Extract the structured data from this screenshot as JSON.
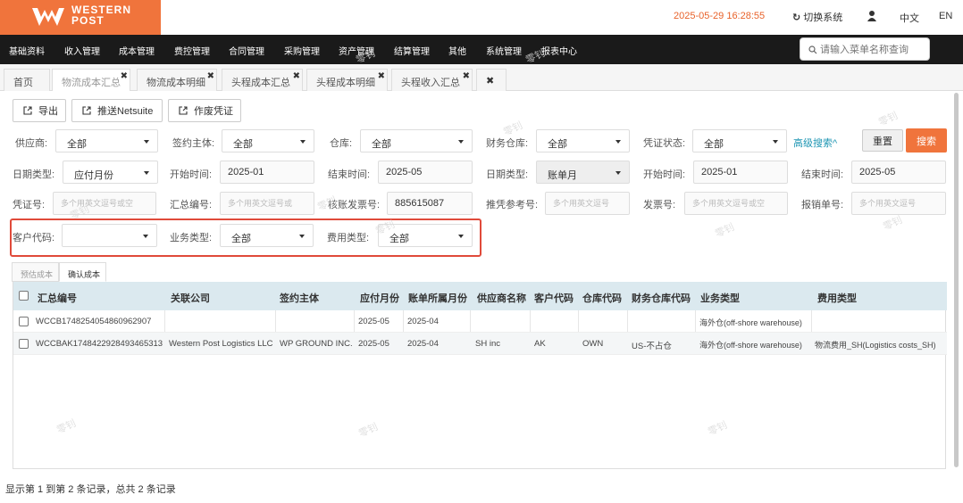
{
  "brand": {
    "line1": "WESTERN",
    "line2": "POST",
    "color": "#f0743c"
  },
  "header": {
    "datetime": "2025-05-29 16:28:55",
    "switch_system": "切换系统",
    "lang_zh": "中文",
    "lang_en": "EN"
  },
  "menu": {
    "items": [
      "基础资料",
      "收入管理",
      "成本管理",
      "费控管理",
      "合同管理",
      "采购管理",
      "资产管理",
      "结算管理",
      "其他",
      "系统管理",
      "报表中心"
    ],
    "search_placeholder": "请输入菜单名称查询"
  },
  "tabs": [
    {
      "label": "首页"
    },
    {
      "label": "物流成本汇总",
      "active": true
    },
    {
      "label": "物流成本明细"
    },
    {
      "label": "头程成本汇总"
    },
    {
      "label": "头程成本明细"
    },
    {
      "label": "头程收入汇总"
    }
  ],
  "toolbar": {
    "export": "导出",
    "push": "推送Netsuite",
    "void": "作废凭证"
  },
  "filters": {
    "supplier": {
      "label": "供应商:",
      "value": "全部"
    },
    "entity": {
      "label": "签约主体:",
      "value": "全部"
    },
    "warehouse": {
      "label": "仓库:",
      "value": "全部"
    },
    "fin_warehouse": {
      "label": "财务仓库:",
      "value": "全部"
    },
    "voucher_status": {
      "label": "凭证状态:",
      "value": "全部"
    },
    "advanced": "高级搜索^",
    "reset": "重置",
    "search": "搜索",
    "date_type1": {
      "label": "日期类型:",
      "value": "应付月份"
    },
    "start1": {
      "label": "开始时间:",
      "value": "2025-01"
    },
    "end1": {
      "label": "结束时间:",
      "value": "2025-05"
    },
    "date_type2": {
      "label": "日期类型:",
      "value": "账单月"
    },
    "start2": {
      "label": "开始时间:",
      "value": "2025-01"
    },
    "end2": {
      "label": "结束时间:",
      "value": "2025-05"
    },
    "voucher_no": {
      "label": "凭证号:",
      "placeholder": "多个用英文逗号或空"
    },
    "summary_no": {
      "label": "汇总编号:",
      "placeholder": "多个用英文逗号或"
    },
    "invoice_check": {
      "label": "核账发票号:",
      "value": "885615087"
    },
    "push_ref": {
      "label": "推凭参考号:",
      "placeholder": "多个用英文逗号"
    },
    "invoice_no": {
      "label": "发票号:",
      "placeholder": "多个用英文逗号或空"
    },
    "reimb_no": {
      "label": "报销单号:",
      "placeholder": "多个用英文逗号"
    },
    "customer_code": {
      "label": "客户代码:",
      "value": ""
    },
    "biz_type": {
      "label": "业务类型:",
      "value": "全部"
    },
    "fee_type": {
      "label": "费用类型:",
      "value": "全部"
    }
  },
  "subtabs": {
    "estimated": "预估成本",
    "confirmed": "确认成本"
  },
  "table": {
    "headers": [
      "汇总编号",
      "关联公司",
      "签约主体",
      "应付月份",
      "账单所属月份",
      "供应商名称",
      "客户代码",
      "仓库代码",
      "财务仓库代码",
      "业务类型",
      "费用类型"
    ],
    "rows": [
      {
        "summary_no": "WCCB1748254054860962907",
        "company": "",
        "entity": "",
        "pay_month": "2025-05",
        "bill_month": "2025-04",
        "supplier": "",
        "customer": "",
        "warehouse": "",
        "fin_wh": "",
        "biz_type": "海外仓(off-shore warehouse)",
        "fee_type": ""
      },
      {
        "summary_no": "WCCBAK1748422928493465313",
        "company": "Western Post Logistics LLC",
        "entity": "WP GROUND INC.",
        "pay_month": "2025-05",
        "bill_month": "2025-04",
        "supplier": "SH inc",
        "customer": "AK",
        "warehouse": "OWN",
        "fin_wh": "US-不占仓",
        "biz_type": "海外仓(off-shore warehouse)",
        "fee_type": "物流费用_SH(Logistics costs_SH)"
      }
    ]
  },
  "footer": "显示第 1 到第 2 条记录，总共 2 条记录",
  "watermark": "零钊"
}
